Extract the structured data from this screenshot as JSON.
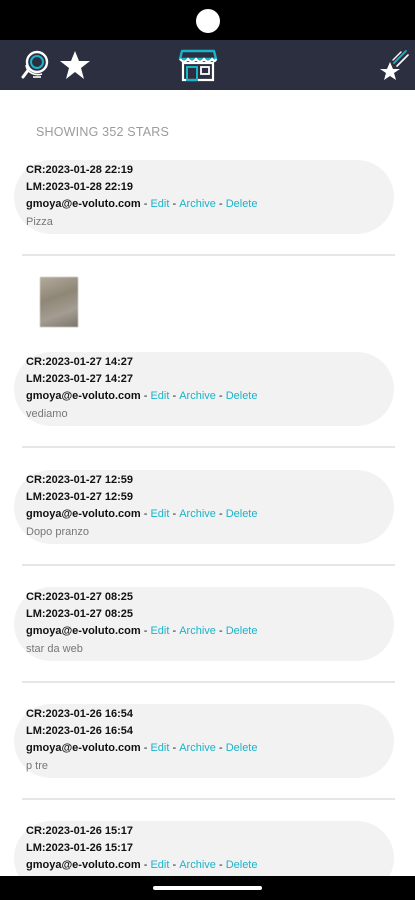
{
  "app_bar": {
    "left_icons": [
      "globe-search-icon",
      "star-icon"
    ],
    "center_icon": "store-icon",
    "right_icon": "shooting-star-icon",
    "colors": {
      "background": "#2c2f40",
      "accent": "#1ab3c9"
    }
  },
  "list": {
    "showing_label": "SHOWING 352 STARS",
    "action_labels": {
      "edit": "Edit",
      "archive": "Archive",
      "delete": "Delete",
      "separator": "-"
    },
    "items": [
      {
        "created": "CR:2023-01-28 22:19",
        "modified": "LM:2023-01-28 22:19",
        "user": "gmoya@e-voluto.com",
        "note": "Pizza"
      },
      {
        "created": "CR:2023-01-27 14:27",
        "modified": "LM:2023-01-27 14:27",
        "user": "gmoya@e-voluto.com",
        "note": "vediamo"
      },
      {
        "created": "CR:2023-01-27 12:59",
        "modified": "LM:2023-01-27 12:59",
        "user": "gmoya@e-voluto.com",
        "note": "Dopo pranzo"
      },
      {
        "created": "CR:2023-01-27 08:25",
        "modified": "LM:2023-01-27 08:25",
        "user": "gmoya@e-voluto.com",
        "note": "star da web"
      },
      {
        "created": "CR:2023-01-26 16:54",
        "modified": "LM:2023-01-26 16:54",
        "user": "gmoya@e-voluto.com",
        "note": "p tre"
      },
      {
        "created": "CR:2023-01-26 15:17",
        "modified": "LM:2023-01-26 15:17",
        "user": "gmoya@e-voluto.com",
        "note": ""
      }
    ]
  }
}
